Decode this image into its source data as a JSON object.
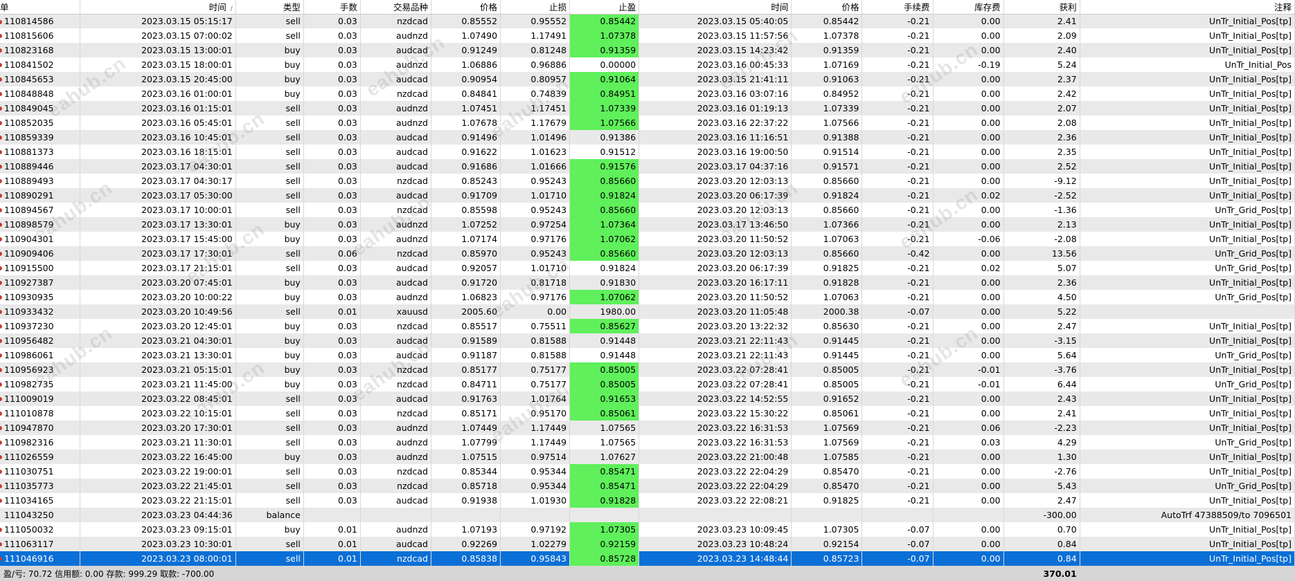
{
  "columns": [
    "单",
    "时间",
    "类型",
    "手数",
    "交易品种",
    "价格",
    "止损",
    "止盈",
    "时间",
    "价格",
    "手续费",
    "库存费",
    "获利",
    "注释"
  ],
  "sort_indicator": "/",
  "watermark_text": "eahub.cn",
  "rows": [
    {
      "order": "110814586",
      "open_time": "2023.03.15 05:15:17",
      "type": "sell",
      "lots": "0.03",
      "symbol": "nzdcad",
      "open_price": "0.85552",
      "sl": "0.95552",
      "tp": "0.85442",
      "tp_hit": true,
      "close_time": "2023.03.15 05:40:05",
      "close_price": "0.85442",
      "commission": "-0.21",
      "swap": "0.00",
      "profit": "2.41",
      "comment": "UnTr_Initial_Pos[tp]"
    },
    {
      "order": "110815606",
      "open_time": "2023.03.15 07:00:02",
      "type": "sell",
      "lots": "0.03",
      "symbol": "audnzd",
      "open_price": "1.07490",
      "sl": "1.17491",
      "tp": "1.07378",
      "tp_hit": true,
      "close_time": "2023.03.15 11:57:56",
      "close_price": "1.07378",
      "commission": "-0.21",
      "swap": "0.00",
      "profit": "2.09",
      "comment": "UnTr_Initial_Pos[tp]"
    },
    {
      "order": "110823168",
      "open_time": "2023.03.15 13:00:01",
      "type": "buy",
      "lots": "0.03",
      "symbol": "audcad",
      "open_price": "0.91249",
      "sl": "0.81248",
      "tp": "0.91359",
      "tp_hit": true,
      "close_time": "2023.03.15 14:23:42",
      "close_price": "0.91359",
      "commission": "-0.21",
      "swap": "0.00",
      "profit": "2.40",
      "comment": "UnTr_Initial_Pos[tp]"
    },
    {
      "order": "110841502",
      "open_time": "2023.03.15 18:00:01",
      "type": "buy",
      "lots": "0.03",
      "symbol": "audnzd",
      "open_price": "1.06886",
      "sl": "0.96886",
      "tp": "0.00000",
      "tp_hit": false,
      "close_time": "2023.03.16 00:45:33",
      "close_price": "1.07169",
      "commission": "-0.21",
      "swap": "-0.19",
      "profit": "5.24",
      "comment": "UnTr_Initial_Pos"
    },
    {
      "order": "110845653",
      "open_time": "2023.03.15 20:45:00",
      "type": "buy",
      "lots": "0.03",
      "symbol": "audcad",
      "open_price": "0.90954",
      "sl": "0.80957",
      "tp": "0.91064",
      "tp_hit": true,
      "close_time": "2023.03.15 21:41:11",
      "close_price": "0.91063",
      "commission": "-0.21",
      "swap": "0.00",
      "profit": "2.37",
      "comment": "UnTr_Initial_Pos[tp]"
    },
    {
      "order": "110848848",
      "open_time": "2023.03.16 01:00:01",
      "type": "buy",
      "lots": "0.03",
      "symbol": "nzdcad",
      "open_price": "0.84841",
      "sl": "0.74839",
      "tp": "0.84951",
      "tp_hit": true,
      "close_time": "2023.03.16 03:07:16",
      "close_price": "0.84952",
      "commission": "-0.21",
      "swap": "0.00",
      "profit": "2.42",
      "comment": "UnTr_Initial_Pos[tp]"
    },
    {
      "order": "110849045",
      "open_time": "2023.03.16 01:15:01",
      "type": "sell",
      "lots": "0.03",
      "symbol": "audnzd",
      "open_price": "1.07451",
      "sl": "1.17451",
      "tp": "1.07339",
      "tp_hit": true,
      "close_time": "2023.03.16 01:19:13",
      "close_price": "1.07339",
      "commission": "-0.21",
      "swap": "0.00",
      "profit": "2.07",
      "comment": "UnTr_Initial_Pos[tp]"
    },
    {
      "order": "110852035",
      "open_time": "2023.03.16 05:45:01",
      "type": "sell",
      "lots": "0.03",
      "symbol": "audnzd",
      "open_price": "1.07678",
      "sl": "1.17679",
      "tp": "1.07566",
      "tp_hit": true,
      "close_time": "2023.03.16 22:37:22",
      "close_price": "1.07566",
      "commission": "-0.21",
      "swap": "0.00",
      "profit": "2.08",
      "comment": "UnTr_Initial_Pos[tp]"
    },
    {
      "order": "110859339",
      "open_time": "2023.03.16 10:45:01",
      "type": "sell",
      "lots": "0.03",
      "symbol": "audcad",
      "open_price": "0.91496",
      "sl": "1.01496",
      "tp": "0.91386",
      "tp_hit": false,
      "close_time": "2023.03.16 11:16:51",
      "close_price": "0.91388",
      "commission": "-0.21",
      "swap": "0.00",
      "profit": "2.36",
      "comment": "UnTr_Initial_Pos[tp]"
    },
    {
      "order": "110881373",
      "open_time": "2023.03.16 18:15:01",
      "type": "sell",
      "lots": "0.03",
      "symbol": "audcad",
      "open_price": "0.91622",
      "sl": "1.01623",
      "tp": "0.91512",
      "tp_hit": false,
      "close_time": "2023.03.16 19:00:50",
      "close_price": "0.91514",
      "commission": "-0.21",
      "swap": "0.00",
      "profit": "2.35",
      "comment": "UnTr_Initial_Pos[tp]"
    },
    {
      "order": "110889446",
      "open_time": "2023.03.17 04:30:01",
      "type": "sell",
      "lots": "0.03",
      "symbol": "audcad",
      "open_price": "0.91686",
      "sl": "1.01666",
      "tp": "0.91576",
      "tp_hit": true,
      "close_time": "2023.03.17 04:37:16",
      "close_price": "0.91571",
      "commission": "-0.21",
      "swap": "0.00",
      "profit": "2.52",
      "comment": "UnTr_Initial_Pos[tp]"
    },
    {
      "order": "110889493",
      "open_time": "2023.03.17 04:30:17",
      "type": "sell",
      "lots": "0.03",
      "symbol": "nzdcad",
      "open_price": "0.85243",
      "sl": "0.95243",
      "tp": "0.85660",
      "tp_hit": true,
      "close_time": "2023.03.20 12:03:13",
      "close_price": "0.85660",
      "commission": "-0.21",
      "swap": "0.00",
      "profit": "-9.12",
      "comment": "UnTr_Initial_Pos[tp]"
    },
    {
      "order": "110890291",
      "open_time": "2023.03.17 05:30:00",
      "type": "sell",
      "lots": "0.03",
      "symbol": "audcad",
      "open_price": "0.91709",
      "sl": "1.01710",
      "tp": "0.91824",
      "tp_hit": true,
      "close_time": "2023.03.20 06:17:39",
      "close_price": "0.91824",
      "commission": "-0.21",
      "swap": "0.02",
      "profit": "-2.52",
      "comment": "UnTr_Initial_Pos[tp]"
    },
    {
      "order": "110894567",
      "open_time": "2023.03.17 10:00:01",
      "type": "sell",
      "lots": "0.03",
      "symbol": "nzdcad",
      "open_price": "0.85598",
      "sl": "0.95243",
      "tp": "0.85660",
      "tp_hit": true,
      "close_time": "2023.03.20 12:03:13",
      "close_price": "0.85660",
      "commission": "-0.21",
      "swap": "0.00",
      "profit": "-1.36",
      "comment": "UnTr_Grid_Pos[tp]"
    },
    {
      "order": "110898579",
      "open_time": "2023.03.17 13:30:01",
      "type": "buy",
      "lots": "0.03",
      "symbol": "audnzd",
      "open_price": "1.07252",
      "sl": "0.97254",
      "tp": "1.07364",
      "tp_hit": true,
      "close_time": "2023.03.17 13:46:50",
      "close_price": "1.07366",
      "commission": "-0.21",
      "swap": "0.00",
      "profit": "2.13",
      "comment": "UnTr_Initial_Pos[tp]"
    },
    {
      "order": "110904301",
      "open_time": "2023.03.17 15:45:00",
      "type": "buy",
      "lots": "0.03",
      "symbol": "audnzd",
      "open_price": "1.07174",
      "sl": "0.97176",
      "tp": "1.07062",
      "tp_hit": true,
      "close_time": "2023.03.20 11:50:52",
      "close_price": "1.07063",
      "commission": "-0.21",
      "swap": "-0.06",
      "profit": "-2.08",
      "comment": "UnTr_Initial_Pos[tp]"
    },
    {
      "order": "110909406",
      "open_time": "2023.03.17 17:30:01",
      "type": "sell",
      "lots": "0.06",
      "symbol": "nzdcad",
      "open_price": "0.85970",
      "sl": "0.95243",
      "tp": "0.85660",
      "tp_hit": true,
      "close_time": "2023.03.20 12:03:13",
      "close_price": "0.85660",
      "commission": "-0.42",
      "swap": "0.00",
      "profit": "13.56",
      "comment": "UnTr_Grid_Pos[tp]"
    },
    {
      "order": "110915500",
      "open_time": "2023.03.17 21:15:01",
      "type": "sell",
      "lots": "0.03",
      "symbol": "audcad",
      "open_price": "0.92057",
      "sl": "1.01710",
      "tp": "0.91824",
      "tp_hit": false,
      "close_time": "2023.03.20 06:17:39",
      "close_price": "0.91825",
      "commission": "-0.21",
      "swap": "0.02",
      "profit": "5.07",
      "comment": "UnTr_Grid_Pos[tp]"
    },
    {
      "order": "110927387",
      "open_time": "2023.03.20 07:45:01",
      "type": "buy",
      "lots": "0.03",
      "symbol": "audcad",
      "open_price": "0.91720",
      "sl": "0.81718",
      "tp": "0.91830",
      "tp_hit": false,
      "close_time": "2023.03.20 16:17:11",
      "close_price": "0.91828",
      "commission": "-0.21",
      "swap": "0.00",
      "profit": "2.36",
      "comment": "UnTr_Initial_Pos[tp]"
    },
    {
      "order": "110930935",
      "open_time": "2023.03.20 10:00:22",
      "type": "buy",
      "lots": "0.03",
      "symbol": "audnzd",
      "open_price": "1.06823",
      "sl": "0.97176",
      "tp": "1.07062",
      "tp_hit": true,
      "close_time": "2023.03.20 11:50:52",
      "close_price": "1.07063",
      "commission": "-0.21",
      "swap": "0.00",
      "profit": "4.50",
      "comment": "UnTr_Grid_Pos[tp]"
    },
    {
      "order": "110933432",
      "open_time": "2023.03.20 10:49:56",
      "type": "sell",
      "lots": "0.01",
      "symbol": "xauusd",
      "open_price": "2005.60",
      "sl": "0.00",
      "tp": "1980.00",
      "tp_hit": false,
      "close_time": "2023.03.20 11:05:48",
      "close_price": "2000.38",
      "commission": "-0.07",
      "swap": "0.00",
      "profit": "5.22",
      "comment": ""
    },
    {
      "order": "110937230",
      "open_time": "2023.03.20 12:45:01",
      "type": "buy",
      "lots": "0.03",
      "symbol": "nzdcad",
      "open_price": "0.85517",
      "sl": "0.75511",
      "tp": "0.85627",
      "tp_hit": true,
      "close_time": "2023.03.20 13:22:32",
      "close_price": "0.85630",
      "commission": "-0.21",
      "swap": "0.00",
      "profit": "2.47",
      "comment": "UnTr_Initial_Pos[tp]"
    },
    {
      "order": "110956482",
      "open_time": "2023.03.21 04:30:01",
      "type": "buy",
      "lots": "0.03",
      "symbol": "audcad",
      "open_price": "0.91589",
      "sl": "0.81588",
      "tp": "0.91448",
      "tp_hit": false,
      "close_time": "2023.03.21 22:11:43",
      "close_price": "0.91445",
      "commission": "-0.21",
      "swap": "0.00",
      "profit": "-3.15",
      "comment": "UnTr_Initial_Pos[tp]"
    },
    {
      "order": "110986061",
      "open_time": "2023.03.21 13:30:01",
      "type": "buy",
      "lots": "0.03",
      "symbol": "audcad",
      "open_price": "0.91187",
      "sl": "0.81588",
      "tp": "0.91448",
      "tp_hit": false,
      "close_time": "2023.03.21 22:11:43",
      "close_price": "0.91445",
      "commission": "-0.21",
      "swap": "0.00",
      "profit": "5.64",
      "comment": "UnTr_Grid_Pos[tp]"
    },
    {
      "order": "110956923",
      "open_time": "2023.03.21 05:15:01",
      "type": "buy",
      "lots": "0.03",
      "symbol": "nzdcad",
      "open_price": "0.85177",
      "sl": "0.75177",
      "tp": "0.85005",
      "tp_hit": true,
      "close_time": "2023.03.22 07:28:41",
      "close_price": "0.85005",
      "commission": "-0.21",
      "swap": "-0.01",
      "profit": "-3.76",
      "comment": "UnTr_Initial_Pos[tp]"
    },
    {
      "order": "110982735",
      "open_time": "2023.03.21 11:45:00",
      "type": "buy",
      "lots": "0.03",
      "symbol": "nzdcad",
      "open_price": "0.84711",
      "sl": "0.75177",
      "tp": "0.85005",
      "tp_hit": true,
      "close_time": "2023.03.22 07:28:41",
      "close_price": "0.85005",
      "commission": "-0.21",
      "swap": "-0.01",
      "profit": "6.44",
      "comment": "UnTr_Grid_Pos[tp]"
    },
    {
      "order": "111009019",
      "open_time": "2023.03.22 08:45:01",
      "type": "sell",
      "lots": "0.03",
      "symbol": "audcad",
      "open_price": "0.91763",
      "sl": "1.01764",
      "tp": "0.91653",
      "tp_hit": true,
      "close_time": "2023.03.22 14:52:55",
      "close_price": "0.91652",
      "commission": "-0.21",
      "swap": "0.00",
      "profit": "2.43",
      "comment": "UnTr_Initial_Pos[tp]"
    },
    {
      "order": "111010878",
      "open_time": "2023.03.22 10:15:01",
      "type": "sell",
      "lots": "0.03",
      "symbol": "nzdcad",
      "open_price": "0.85171",
      "sl": "0.95170",
      "tp": "0.85061",
      "tp_hit": true,
      "close_time": "2023.03.22 15:30:22",
      "close_price": "0.85061",
      "commission": "-0.21",
      "swap": "0.00",
      "profit": "2.41",
      "comment": "UnTr_Initial_Pos[tp]"
    },
    {
      "order": "110947870",
      "open_time": "2023.03.20 17:30:01",
      "type": "sell",
      "lots": "0.03",
      "symbol": "audnzd",
      "open_price": "1.07449",
      "sl": "1.17449",
      "tp": "1.07565",
      "tp_hit": false,
      "close_time": "2023.03.22 16:31:53",
      "close_price": "1.07569",
      "commission": "-0.21",
      "swap": "0.06",
      "profit": "-2.23",
      "comment": "UnTr_Initial_Pos[tp]"
    },
    {
      "order": "110982316",
      "open_time": "2023.03.21 11:30:01",
      "type": "sell",
      "lots": "0.03",
      "symbol": "audnzd",
      "open_price": "1.07799",
      "sl": "1.17449",
      "tp": "1.07565",
      "tp_hit": false,
      "close_time": "2023.03.22 16:31:53",
      "close_price": "1.07569",
      "commission": "-0.21",
      "swap": "0.03",
      "profit": "4.29",
      "comment": "UnTr_Grid_Pos[tp]"
    },
    {
      "order": "111026559",
      "open_time": "2023.03.22 16:45:00",
      "type": "buy",
      "lots": "0.03",
      "symbol": "audnzd",
      "open_price": "1.07515",
      "sl": "0.97514",
      "tp": "1.07627",
      "tp_hit": false,
      "close_time": "2023.03.22 21:00:48",
      "close_price": "1.07585",
      "commission": "-0.21",
      "swap": "0.00",
      "profit": "1.30",
      "comment": "UnTr_Initial_Pos[tp]"
    },
    {
      "order": "111030751",
      "open_time": "2023.03.22 19:00:01",
      "type": "sell",
      "lots": "0.03",
      "symbol": "nzdcad",
      "open_price": "0.85344",
      "sl": "0.95344",
      "tp": "0.85471",
      "tp_hit": true,
      "close_time": "2023.03.22 22:04:29",
      "close_price": "0.85470",
      "commission": "-0.21",
      "swap": "0.00",
      "profit": "-2.76",
      "comment": "UnTr_Initial_Pos[tp]"
    },
    {
      "order": "111035773",
      "open_time": "2023.03.22 21:45:01",
      "type": "sell",
      "lots": "0.03",
      "symbol": "nzdcad",
      "open_price": "0.85718",
      "sl": "0.95344",
      "tp": "0.85471",
      "tp_hit": true,
      "close_time": "2023.03.22 22:04:29",
      "close_price": "0.85470",
      "commission": "-0.21",
      "swap": "0.00",
      "profit": "5.43",
      "comment": "UnTr_Grid_Pos[tp]"
    },
    {
      "order": "111034165",
      "open_time": "2023.03.22 21:15:01",
      "type": "sell",
      "lots": "0.03",
      "symbol": "audcad",
      "open_price": "0.91938",
      "sl": "1.01930",
      "tp": "0.91828",
      "tp_hit": true,
      "close_time": "2023.03.22 22:08:21",
      "close_price": "0.91825",
      "commission": "-0.21",
      "swap": "0.00",
      "profit": "2.47",
      "comment": "UnTr_Initial_Pos[tp]"
    },
    {
      "order": "111043250",
      "open_time": "2023.03.23 04:44:36",
      "type": "balance",
      "lots": "",
      "symbol": "",
      "open_price": "",
      "sl": "",
      "tp": "",
      "tp_hit": false,
      "close_time": "",
      "close_price": "",
      "commission": "",
      "swap": "",
      "profit": "-300.00",
      "comment": "AutoTrf 47388509/to 7096501",
      "no_dot": true
    },
    {
      "order": "111050032",
      "open_time": "2023.03.23 09:15:01",
      "type": "buy",
      "lots": "0.01",
      "symbol": "audnzd",
      "open_price": "1.07193",
      "sl": "0.97192",
      "tp": "1.07305",
      "tp_hit": true,
      "close_time": "2023.03.23 10:09:45",
      "close_price": "1.07305",
      "commission": "-0.07",
      "swap": "0.00",
      "profit": "0.70",
      "comment": "UnTr_Initial_Pos[tp]"
    },
    {
      "order": "111063117",
      "open_time": "2023.03.23 10:30:01",
      "type": "sell",
      "lots": "0.01",
      "symbol": "audcad",
      "open_price": "0.92269",
      "sl": "1.02279",
      "tp": "0.92159",
      "tp_hit": true,
      "close_time": "2023.03.23 10:48:24",
      "close_price": "0.92154",
      "commission": "-0.07",
      "swap": "0.00",
      "profit": "0.84",
      "comment": "UnTr_Initial_Pos[tp]"
    },
    {
      "order": "111046916",
      "open_time": "2023.03.23 08:00:01",
      "type": "sell",
      "lots": "0.01",
      "symbol": "nzdcad",
      "open_price": "0.85838",
      "sl": "0.95843",
      "tp": "0.85728",
      "tp_hit": true,
      "close_time": "2023.03.23 14:48:44",
      "close_price": "0.85723",
      "commission": "-0.07",
      "swap": "0.00",
      "profit": "0.84",
      "comment": "UnTr_Initial_Pos[tp]",
      "selected": true
    }
  ],
  "footer": {
    "summary": "盈/亏: 70.72  信用额: 0.00  存款: 999.29  取款: -700.00",
    "total_profit": "370.01"
  },
  "colors": {
    "tp_highlight": "#5ff05b",
    "selected_row": "#0a6fd6",
    "row_alt": "#e9e9e9",
    "footer_bg": "#d6d6d6",
    "order_dot": "#c8392e"
  }
}
